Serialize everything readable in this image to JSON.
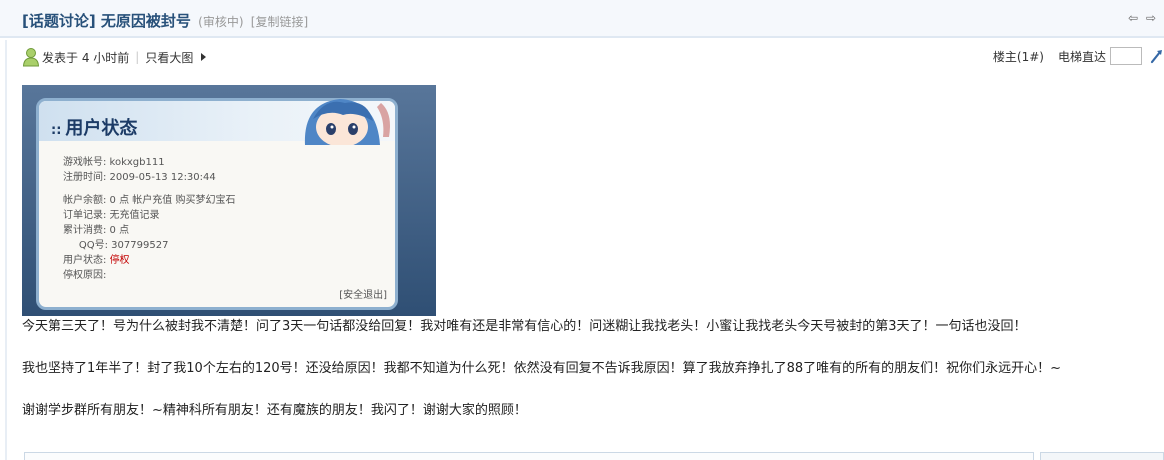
{
  "thread": {
    "title": "[话题讨论] 无原因被封号",
    "status": "(审核中)",
    "copy_link": "[复制链接]"
  },
  "post_meta": {
    "posted": "发表于 4 小时前",
    "separator": "|",
    "view_large": "只看大图"
  },
  "floor": {
    "label": "楼主(1#)",
    "elevator_label": "电梯直达",
    "elevator_value": ""
  },
  "screenshot_panel": {
    "title": "用户状态",
    "title_prefix": "::",
    "rows": [
      "游戏帐号: kokxgb111",
      "注册时间: 2009-05-13 12:30:44",
      "帐户余额: 0 点 帐户充值    购买梦幻宝石",
      "订单记录: 无充值记录",
      "累计消费: 0 点",
      "     QQ号: 307799527"
    ],
    "status_label": "用户状态: ",
    "status_value": "停权",
    "ban_reason_label": "停权原因:",
    "logout": "[安全退出]"
  },
  "content": {
    "p1": "今天第三天了！号为什么被封我不清楚！问了3天一句话都没给回复！我对唯有还是非常有信心的！问迷糊让我找老头！小蜜让我找老头今天号被封的第3天了！一句话也没回！",
    "p2": "我也坚持了1年半了！封了我10个左右的120号！还没给原因！我都不知道为什么死！依然没有回复不告诉我原因！算了我放弃挣扎了88了唯有的所有的朋友们！祝你们永远开心！~",
    "p3": "谢谢学步群所有朋友！~精神科所有朋友！还有魔族的朋友！我闪了！谢谢大家的照顾！"
  },
  "colors": {
    "title": "#28517a",
    "ban_status": "#c30000"
  },
  "icons": {
    "prev": "prev-thread-icon",
    "next": "next-thread-icon",
    "author": "user-avatar-icon",
    "jump": "jump-icon"
  }
}
